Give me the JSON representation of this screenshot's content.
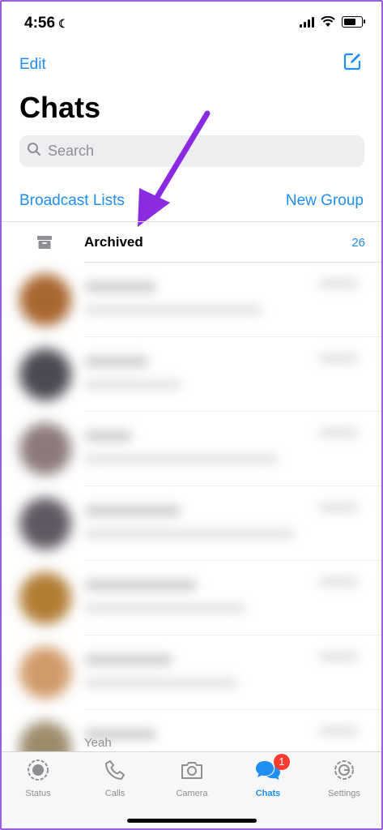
{
  "status_bar": {
    "time": "4:56"
  },
  "header": {
    "edit_label": "Edit",
    "title": "Chats"
  },
  "search": {
    "placeholder": "Search"
  },
  "lists": {
    "broadcast_label": "Broadcast Lists",
    "new_group_label": "New Group"
  },
  "archived": {
    "label": "Archived",
    "count": "26"
  },
  "chats": [
    {
      "avatar_color": "#a8662f",
      "preview_last": ""
    },
    {
      "avatar_color": "#4a4a52",
      "preview_last": ""
    },
    {
      "avatar_color": "#8c7a7a",
      "preview_last": ""
    },
    {
      "avatar_color": "#5f5862",
      "preview_last": ""
    },
    {
      "avatar_color": "#b17d35",
      "preview_last": ""
    },
    {
      "avatar_color": "#d09b6a",
      "preview_last": ""
    },
    {
      "avatar_color": "#9b8c6c",
      "preview_last": "Yeah"
    }
  ],
  "tabs": [
    {
      "label": "Status",
      "icon": "status-icon"
    },
    {
      "label": "Calls",
      "icon": "phone-icon"
    },
    {
      "label": "Camera",
      "icon": "camera-icon"
    },
    {
      "label": "Chats",
      "icon": "chats-icon",
      "badge": "1"
    },
    {
      "label": "Settings",
      "icon": "gear-icon"
    }
  ],
  "colors": {
    "accent": "#1f8ef1",
    "badge": "#ff3b30",
    "annotation_arrow": "#8a2be2"
  }
}
